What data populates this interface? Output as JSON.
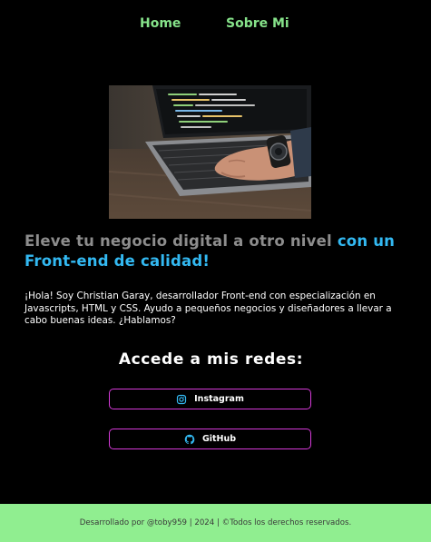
{
  "nav": {
    "home_label": "Home",
    "about_label": "Sobre Mi"
  },
  "hero": {
    "image_subject": "hands-typing-on-laptop"
  },
  "headline": {
    "muted_text": "Eleve tu negocio digital a otro nivel ",
    "accent_text": "con un Front-end de calidad!"
  },
  "intro": {
    "text": "¡Hola! Soy Christian Garay, desarrollador Front-end con especialización en Javascripts, HTML y CSS. Ayudo a pequeños negocios y diseñadores a llevar a cabo buenas ideas. ¿Hablamos?"
  },
  "social": {
    "title": "Accede a mis redes:",
    "buttons": [
      {
        "label": "Instagram",
        "icon": "instagram-icon"
      },
      {
        "label": "GitHub",
        "icon": "github-icon"
      }
    ]
  },
  "footer": {
    "text": "Desarrollado por @toby959 | 2024 | ©Todos los derechos reservados."
  },
  "colors": {
    "background": "#000000",
    "nav_link": "#86e38a",
    "headline_muted": "#8d8d8d",
    "headline_accent": "#33b9f2",
    "button_border": "#d63ad9",
    "icon_color": "#33b9f2",
    "footer_bg": "#90ee90"
  }
}
